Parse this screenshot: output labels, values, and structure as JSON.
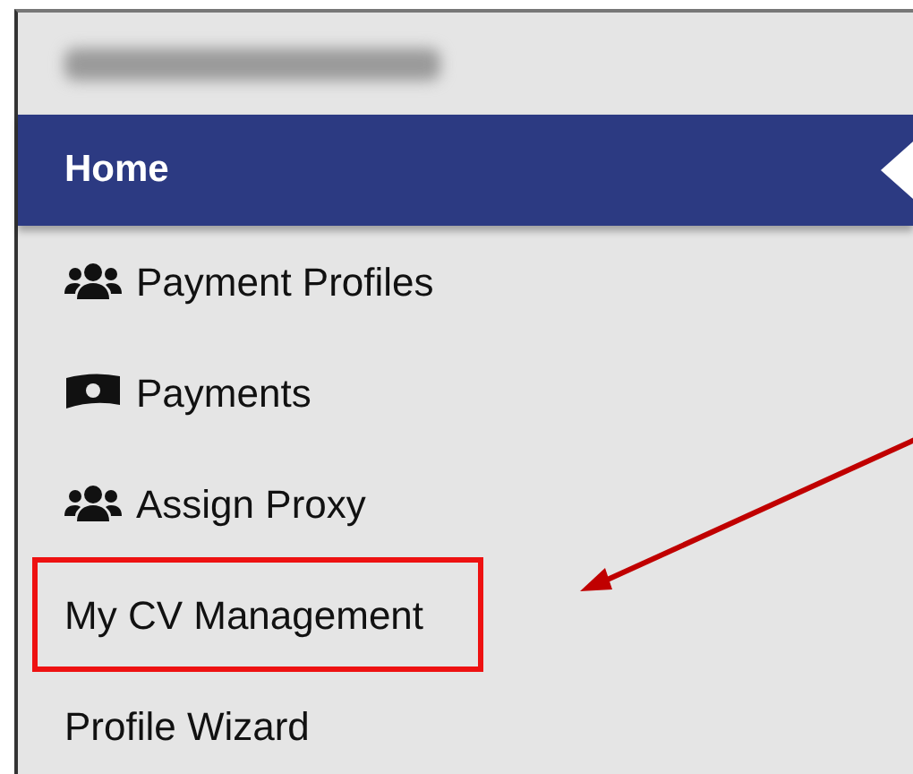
{
  "header": {
    "redacted": true
  },
  "menu": [
    {
      "label": "Home",
      "selected": true,
      "kind": "plain",
      "highlighted": false
    },
    {
      "label": "Payment Profiles",
      "selected": false,
      "kind": "people",
      "highlighted": false
    },
    {
      "label": "Payments",
      "selected": false,
      "kind": "money",
      "highlighted": false
    },
    {
      "label": "Assign Proxy",
      "selected": false,
      "kind": "people",
      "highlighted": false
    },
    {
      "label": "My CV Management",
      "selected": false,
      "kind": "plain",
      "highlighted": true
    },
    {
      "label": "Profile Wizard",
      "selected": false,
      "kind": "plain",
      "highlighted": false
    }
  ]
}
